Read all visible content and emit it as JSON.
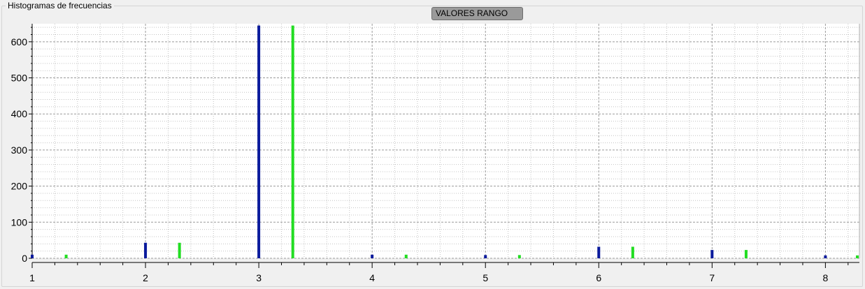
{
  "group_title": "Histogramas de frecuencias",
  "range_button": "VALORES RANGO",
  "colors": {
    "series_a": "#0a1a9c",
    "series_b": "#22dd22",
    "grid": "#9a9a9a"
  },
  "chart_data": {
    "type": "bar",
    "title": "",
    "xlabel": "",
    "ylabel": "",
    "xlim": [
      1,
      8.3
    ],
    "ylim": [
      0,
      650
    ],
    "x_ticks": [
      1,
      2,
      3,
      4,
      5,
      6,
      7,
      8
    ],
    "y_ticks": [
      0,
      100,
      200,
      300,
      400,
      500,
      600
    ],
    "grid": true,
    "series": [
      {
        "x": [
          1,
          2,
          3,
          4,
          5,
          6,
          7,
          8
        ],
        "values": [
          10,
          43,
          645,
          10,
          9,
          32,
          23,
          8
        ],
        "color": "#0a1a9c"
      },
      {
        "x": [
          1.3,
          2.3,
          3.3,
          4.3,
          5.3,
          6.3,
          7.3,
          8.3
        ],
        "values": [
          10,
          43,
          645,
          10,
          9,
          32,
          23,
          8
        ],
        "color": "#22dd22"
      }
    ]
  }
}
